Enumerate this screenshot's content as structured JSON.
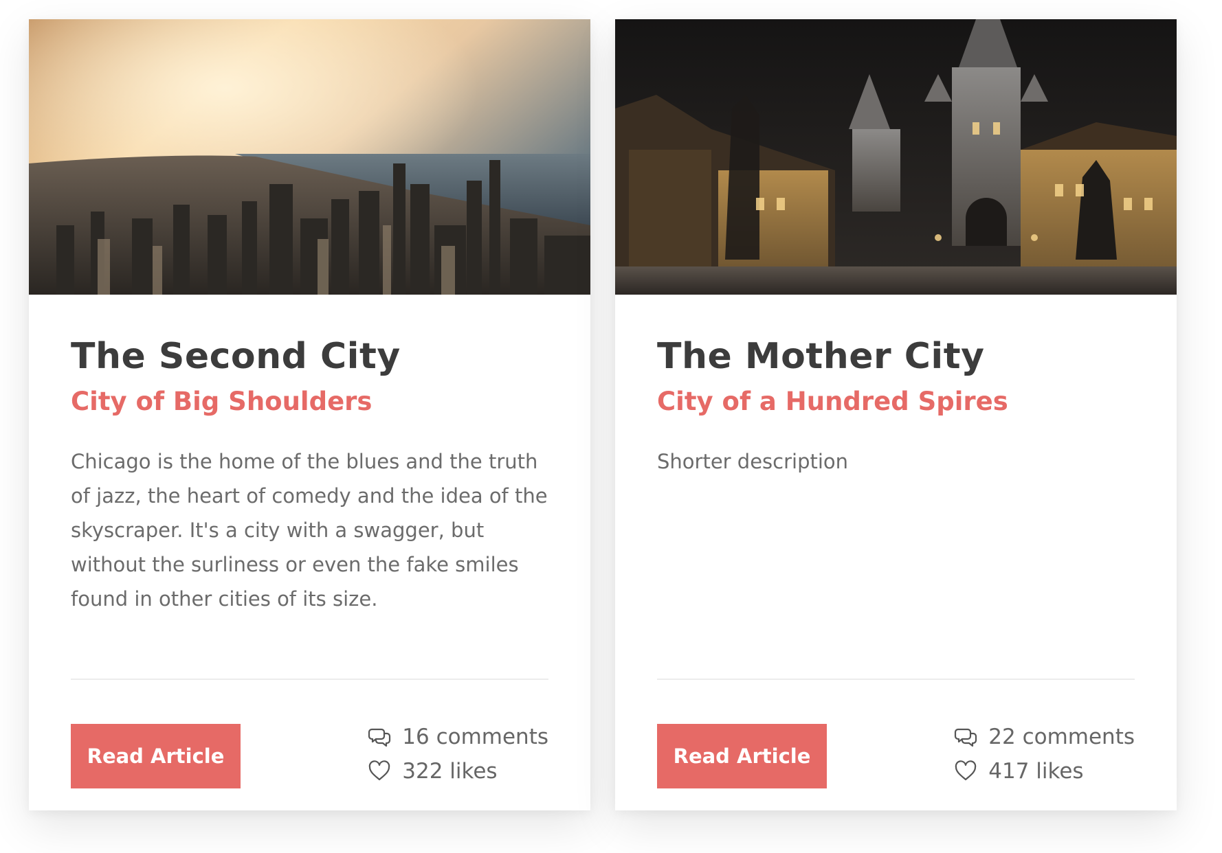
{
  "colors": {
    "accent": "#e66a66",
    "title": "#3c3c3c",
    "text": "#6b6b6b",
    "divider": "#ececec"
  },
  "cards": [
    {
      "image": "city-skyline-sunset-image",
      "title": "The Second City",
      "subtitle": "City of Big Shoulders",
      "description": "Chicago is the home of the blues and the truth of jazz, the heart of comedy and the idea of the skyscraper. It's a city with a swagger, but without the surliness or even the fake smiles found in other cities of its size.",
      "button_label": "Read Article",
      "comments": "16 comments",
      "likes": "322 likes",
      "comments_icon": "comments-icon",
      "likes_icon": "heart-icon"
    },
    {
      "image": "old-town-bridge-night-image",
      "title": "The Mother City",
      "subtitle": "City of a Hundred Spires",
      "description": "Shorter description",
      "button_label": "Read Article",
      "comments": "22 comments",
      "likes": "417 likes",
      "comments_icon": "comments-icon",
      "likes_icon": "heart-icon"
    }
  ]
}
